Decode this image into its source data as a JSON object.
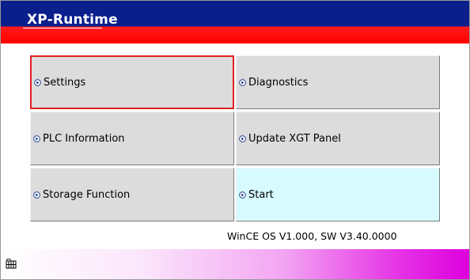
{
  "window": {
    "title": "XP-Runtime"
  },
  "menu": {
    "buttons": [
      {
        "label": "Settings",
        "icon": "circle-arrow-icon",
        "selected": true
      },
      {
        "label": "Diagnostics",
        "icon": "circle-arrow-icon",
        "selected": false
      },
      {
        "label": "PLC Information",
        "icon": "circle-arrow-icon",
        "selected": false
      },
      {
        "label": "Update XGT Panel",
        "icon": "circle-arrow-icon",
        "selected": false
      },
      {
        "label": "Storage Function",
        "icon": "circle-arrow-icon",
        "selected": false
      },
      {
        "label": "Start",
        "icon": "circle-arrow-icon",
        "selected": false
      }
    ]
  },
  "footer": {
    "version_text": "WinCE OS V1.000, SW V3.40.0000"
  },
  "statusbar": {
    "icon": "keyboard-icon"
  },
  "colors": {
    "title_blue": "#0a1f8c",
    "title_red": "#ff0000",
    "selection_border": "#e02020",
    "start_button_bg": "#d6fafd",
    "button_bg": "#dcdcdc",
    "statusbar_magenta": "#dd00dd"
  }
}
